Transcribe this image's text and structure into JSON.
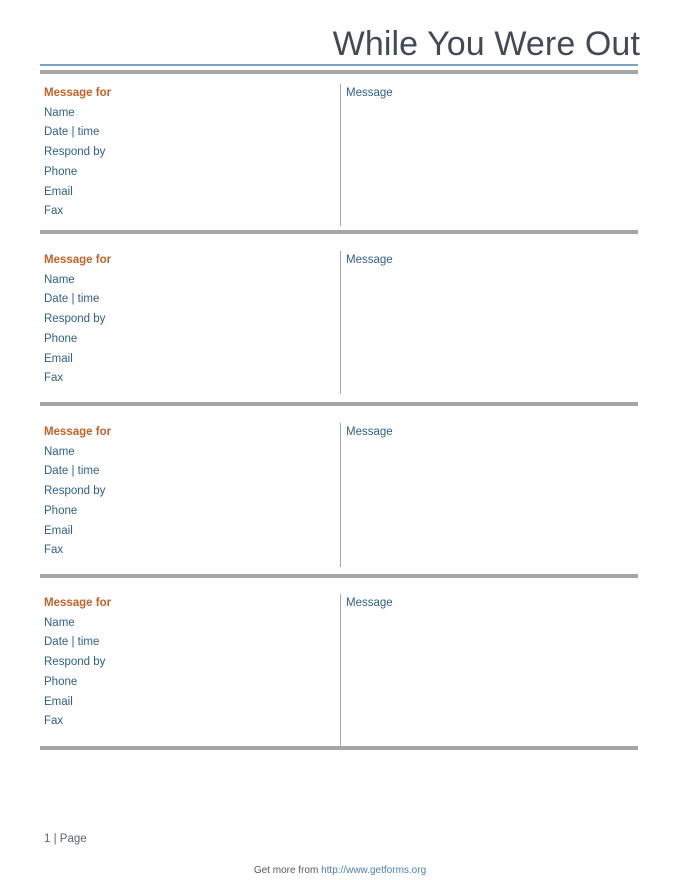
{
  "document": {
    "title": "While You Were Out",
    "page_number_text": "1 | Page"
  },
  "colors": {
    "title": "#434a57",
    "heading_orange": "#c0622a",
    "label_blue": "#2f5f8c",
    "rule_blue": "#7aa3c8",
    "rule_gray": "#a6a6a6",
    "link_blue": "#4a7fb5"
  },
  "blocks": [
    {
      "heading": "Message for",
      "fields": [
        "Name",
        "Date | time",
        "Respond by",
        "Phone",
        "Email",
        "Fax"
      ],
      "message_label": "Message"
    },
    {
      "heading": "Message for",
      "fields": [
        "Name",
        "Date | time",
        "Respond by",
        "Phone",
        "Email",
        "Fax"
      ],
      "message_label": "Message"
    },
    {
      "heading": "Message for",
      "fields": [
        "Name",
        "Date | time",
        "Respond by",
        "Phone",
        "Email",
        "Fax"
      ],
      "message_label": "Message"
    },
    {
      "heading": "Message for",
      "fields": [
        "Name",
        "Date | time",
        "Respond by",
        "Phone",
        "Email",
        "Fax"
      ],
      "message_label": "Message"
    }
  ],
  "footer": {
    "prefix": "Get more from ",
    "link_text": "http://www.getforms.org"
  }
}
